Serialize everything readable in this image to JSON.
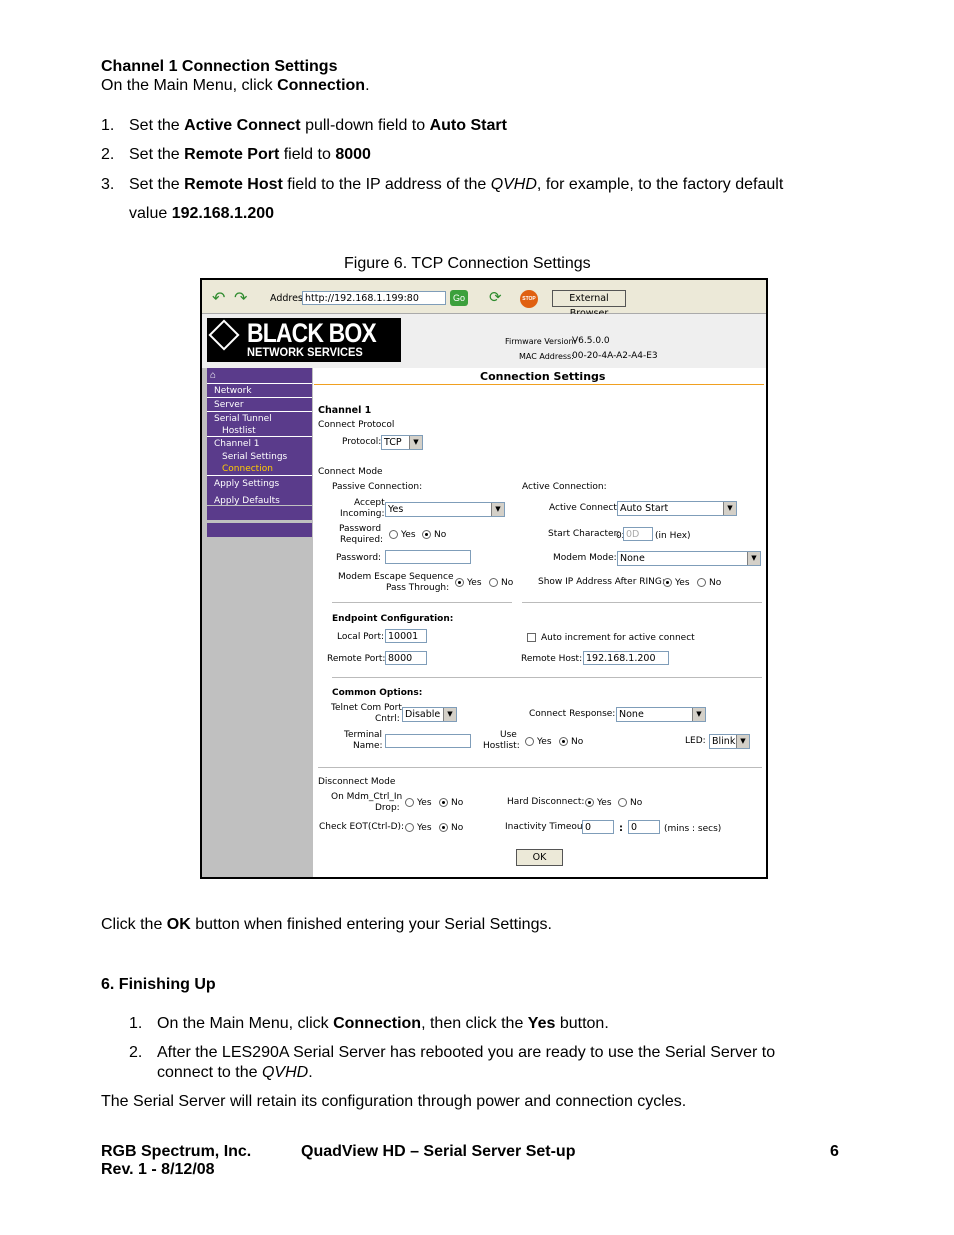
{
  "intro": {
    "heading": "Channel 1 Connection Settings",
    "line_prefix": "On the Main Menu, click ",
    "line_bold": "Connection",
    "line_suffix": "."
  },
  "steps": [
    {
      "num": "1.",
      "a": "Set the ",
      "b1": "Active Connect",
      "c": " pull-down field to ",
      "b2": "Auto Start"
    },
    {
      "num": "2.",
      "a": "Set the ",
      "b1": "Remote Port",
      "c": " field to ",
      "b2": "8000"
    },
    {
      "num": "3.",
      "a": "Set the ",
      "b1": "Remote Host",
      "c": " field to the IP address of the ",
      "i": "QVHD",
      "d": ", for example, to the factory default",
      "e": "value ",
      "b2": "192.168.1.200"
    }
  ],
  "figure_caption": "Figure 6. TCP Connection Settings",
  "browser": {
    "address_label": "Address",
    "address_value": "http://192.168.1.199:80",
    "go_label": "Go",
    "stop_label": "STOP",
    "external_label": "External Browser"
  },
  "brand": {
    "logo_main": "BLACK BOX",
    "logo_sub": "NETWORK SERVICES",
    "firmware_label": "Firmware Version:",
    "firmware_value": "V6.5.0.0",
    "mac_label": "MAC Address:",
    "mac_value": "00-20-4A-A2-A4-E3"
  },
  "nav": {
    "items": [
      "Network",
      "Server",
      "Serial Tunnel",
      "Hostlist",
      "Channel 1",
      "Serial Settings",
      "Connection",
      "Apply Settings",
      "Apply Defaults"
    ]
  },
  "form": {
    "title": "Connection Settings",
    "channel": "Channel 1",
    "connect_protocol": "Connect Protocol",
    "protocol_label": "Protocol:",
    "protocol_value": "TCP",
    "connect_mode": "Connect Mode",
    "passive_title": "Passive Connection:",
    "active_title": "Active Connection:",
    "accept_label_1": "Accept",
    "accept_label_2": "Incoming:",
    "accept_value": "Yes",
    "pwreq_label_1": "Password",
    "pwreq_label_2": "Required:",
    "yes": "Yes",
    "no": "No",
    "password_label": "Password:",
    "password_value": "",
    "escape_label_1": "Modem Escape Sequence",
    "escape_label_2": "Pass Through:",
    "active_connect_label": "Active Connect:",
    "active_connect_value": "Auto Start",
    "start_char_label": "Start Character:",
    "start_char_prefix": "0x",
    "start_char_value": "0D",
    "start_char_suffix": "(in Hex)",
    "modem_mode_label": "Modem Mode:",
    "modem_mode_value": "None",
    "show_ip_label": "Show IP Address After RING:",
    "endpoint_title": "Endpoint Configuration:",
    "local_port_label": "Local Port:",
    "local_port_value": "10001",
    "auto_inc_label": "Auto increment for active connect",
    "remote_port_label": "Remote Port:",
    "remote_port_value": "8000",
    "remote_host_label": "Remote Host:",
    "remote_host_value": "192.168.1.200",
    "common_title": "Common Options:",
    "telnet_label_1": "Telnet Com Port",
    "telnet_label_2": "Cntrl:",
    "telnet_value": "Disable",
    "conn_resp_label": "Connect Response:",
    "conn_resp_value": "None",
    "terminal_label_1": "Terminal",
    "terminal_label_2": "Name:",
    "terminal_value": "",
    "use_host_1": "Use",
    "use_host_2": "Hostlist:",
    "led_label": "LED:",
    "led_value": "Blink",
    "disconnect_title": "Disconnect Mode",
    "mdm_label_1": "On Mdm_Ctrl_In",
    "mdm_label_2": "Drop:",
    "hard_disc_label": "Hard Disconnect:",
    "check_eot_label": "Check EOT(Ctrl-D):",
    "inactivity_label": "Inactivity Timeout:",
    "inactivity_min": "0",
    "colon": ":",
    "inactivity_sec": "0",
    "inactivity_unit": "(mins : secs)",
    "ok_label": "OK"
  },
  "after_figure": {
    "a": "Click the ",
    "b": "OK",
    "c": " button when finished entering your Serial Settings."
  },
  "section6": {
    "heading": "6.  Finishing Up",
    "items": [
      {
        "num": "1.",
        "a": "On the Main Menu, click ",
        "b1": "Connection",
        "c": ", then click the ",
        "b2": "Yes",
        "d": " button."
      },
      {
        "num": "2.",
        "a": "After the LES290A Serial Server has rebooted you are ready to use the Serial Server to",
        "b": "connect to the ",
        "i": "QVHD",
        "c": "."
      }
    ],
    "closing": "The Serial Server will retain its configuration through power and connection cycles."
  },
  "footer": {
    "company": "RGB Spectrum, Inc.",
    "rev": "Rev. 1 - 8/12/08",
    "title": "QuadView HD – Serial Server Set-up",
    "page": "6"
  }
}
